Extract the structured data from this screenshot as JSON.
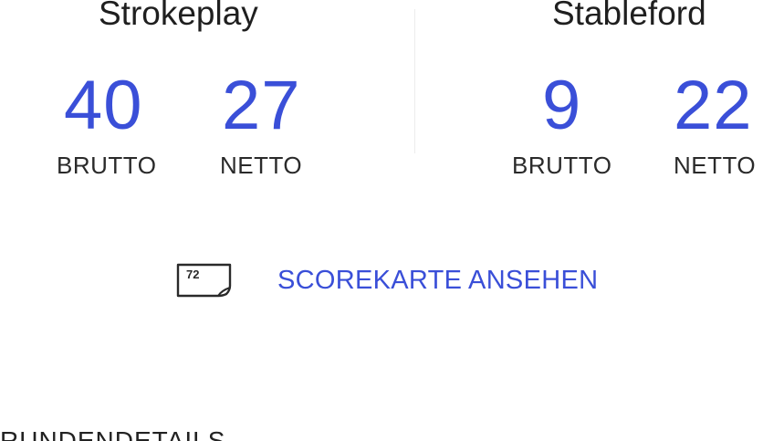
{
  "strokeplay": {
    "title": "Strokeplay",
    "brutto_value": "40",
    "brutto_label": "BRUTTO",
    "netto_value": "27",
    "netto_label": "NETTO"
  },
  "stableford": {
    "title": "Stableford",
    "brutto_value": "9",
    "brutto_label": "BRUTTO",
    "netto_value": "22",
    "netto_label": "NETTO"
  },
  "scorecard": {
    "icon_name": "scorecard-icon",
    "icon_text": "72",
    "label": "SCOREKARTE ANSEHEN"
  },
  "section": {
    "title": "RUNDENDETAILS"
  },
  "colors": {
    "accent": "#3a4fd8",
    "text": "#222222",
    "divider": "#ececec"
  }
}
